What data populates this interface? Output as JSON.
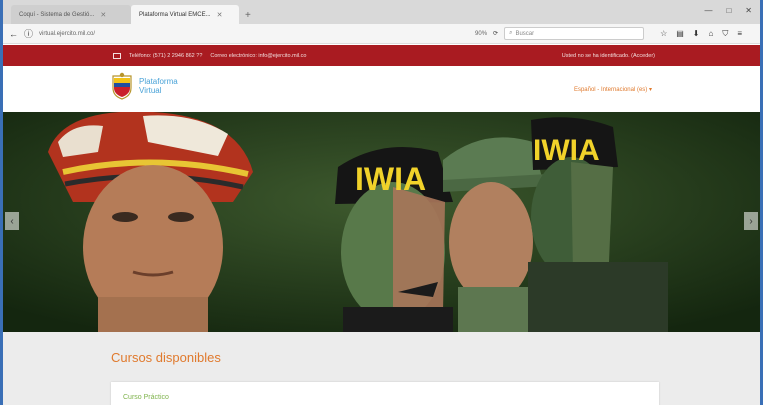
{
  "browser": {
    "tabs": [
      {
        "label": "Coquí - Sistema de Gestió..."
      },
      {
        "label": "Plataforma Virtual EMCE..."
      }
    ],
    "new_tab_label": "+",
    "url": "virtual.ejercito.mil.co/",
    "zoom": "90%",
    "search_placeholder": "Buscar"
  },
  "topbar": {
    "phone": "Teléfono: (571) 2 2946 862 ??",
    "email": "Correo electrónico: info@ejercito.mil.co",
    "links": "Usted no se ha identificado. (Acceder)"
  },
  "header": {
    "logo_line1": "Plataforma",
    "logo_line2": "Virtual",
    "language": "Español - Internacional (es) ▾"
  },
  "hero": {
    "headband_text_1": "IWIA",
    "headband_text_2": "IWIA"
  },
  "main": {
    "section_title": "Cursos disponibles",
    "course_title": "Curso Práctico"
  },
  "colors": {
    "topbar_red": "#a91b21",
    "accent_orange": "#e07a2e",
    "logo_blue": "#4aa3d8",
    "course_green": "#7fb34c"
  }
}
